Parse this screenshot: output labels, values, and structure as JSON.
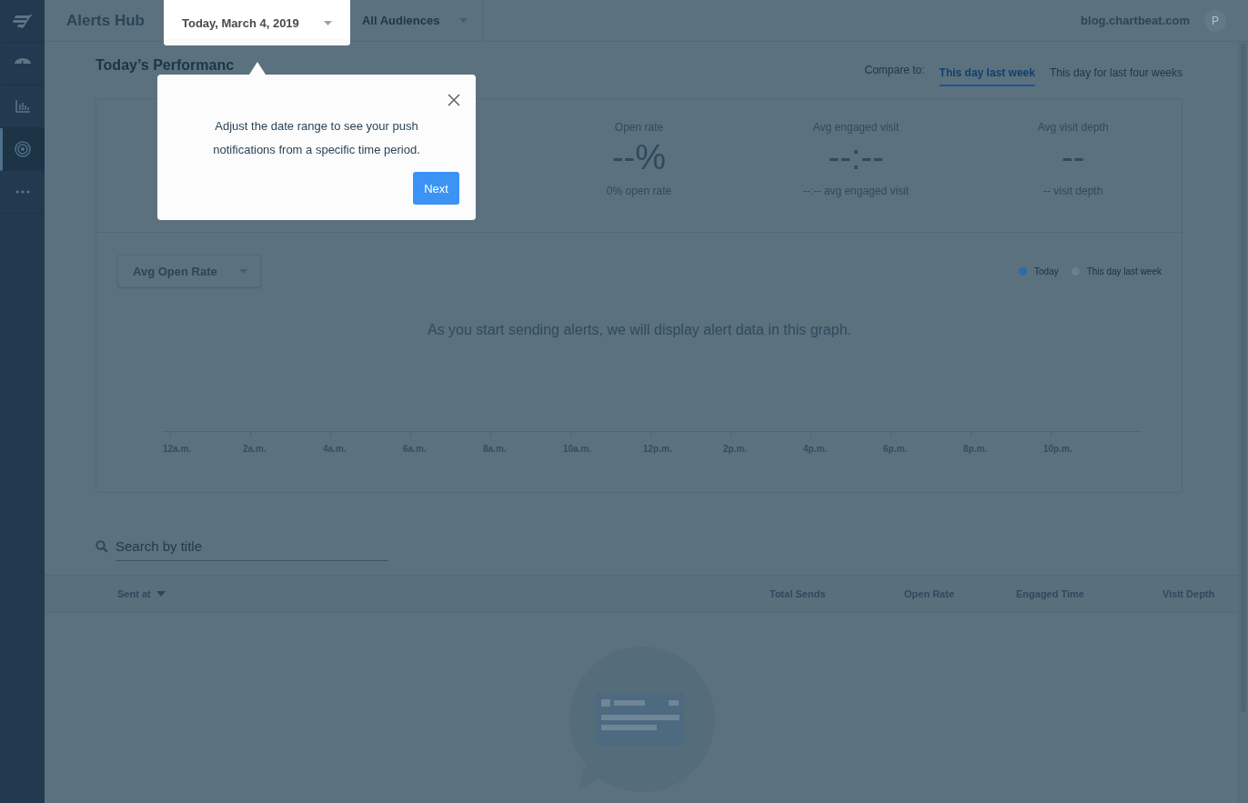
{
  "sidebar": {
    "items": [
      {
        "kind": "logo",
        "selected": false
      },
      {
        "kind": "radar",
        "selected": false
      },
      {
        "kind": "chart",
        "selected": false
      },
      {
        "kind": "target",
        "selected": true
      },
      {
        "kind": "more",
        "selected": false
      }
    ]
  },
  "header": {
    "title": "Alerts Hub",
    "date_dropdown": "Today, March 4, 2019",
    "audience_dropdown": "All Audiences",
    "site": "blog.chartbeat.com",
    "avatar": "P"
  },
  "performance": {
    "title": "Today’s Performanc",
    "compare_label": "Compare to:",
    "compare_tabs": [
      {
        "label": "This day last week",
        "selected": true
      },
      {
        "label": "This day for last four weeks",
        "selected": false
      }
    ],
    "stats": [
      {
        "label": "Open rate",
        "value": "--%",
        "note": "0% open rate"
      },
      {
        "label": "Avg engaged visit",
        "value": "--:--",
        "note": "--:-- avg engaged visit"
      },
      {
        "label": "Avg visit depth",
        "value": "--",
        "note": "-- visit depth"
      }
    ]
  },
  "graph": {
    "metric_dropdown": "Avg Open Rate",
    "legend": [
      {
        "label": "Today",
        "color": "#2d6aa8"
      },
      {
        "label": "This day last week",
        "color": "#6b808d"
      }
    ],
    "empty_message": "As you start sending alerts, we will display alert data in this graph.",
    "x_labels": [
      "12a.m.",
      "2a.m.",
      "4a.m.",
      "6a.m.",
      "8a.m.",
      "10a.m.",
      "12p.m.",
      "2p.m.",
      "4p.m.",
      "6p.m.",
      "8p.m.",
      "10p.m."
    ]
  },
  "search": {
    "placeholder": "Search by title"
  },
  "table": {
    "columns": [
      {
        "label": "Sent at",
        "sorted": true
      },
      {
        "label": "Total Sends",
        "sorted": false
      },
      {
        "label": "Open Rate",
        "sorted": false
      },
      {
        "label": "Engaged Time",
        "sorted": false
      },
      {
        "label": "Visit Depth",
        "sorted": false
      }
    ]
  },
  "popover": {
    "message": "Adjust the date range to see your push notifications from a specific time period.",
    "button": "Next"
  }
}
